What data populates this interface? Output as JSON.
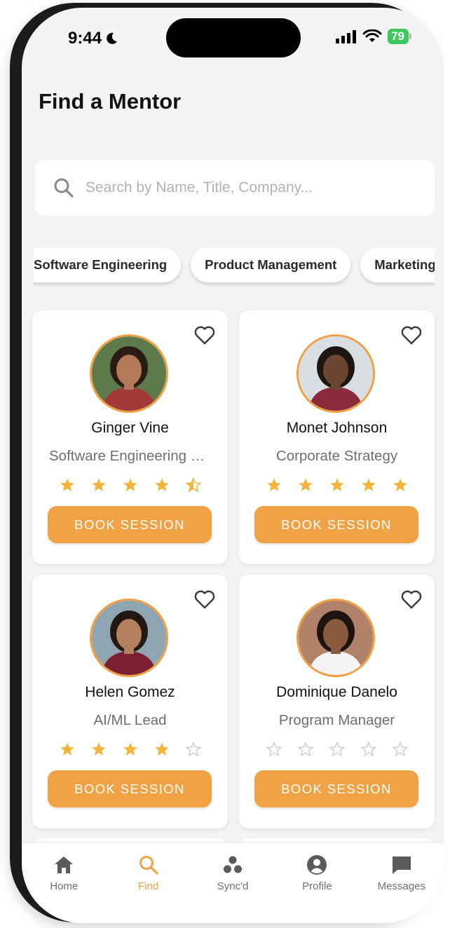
{
  "status_bar": {
    "time": "9:44",
    "battery": "79"
  },
  "header": {
    "title": "Find a Mentor"
  },
  "search": {
    "placeholder": "Search by Name, Title, Company..."
  },
  "categories": [
    "Software Engineering",
    "Product Management",
    "Marketing"
  ],
  "mentors": [
    {
      "name": "Ginger Vine",
      "title": "Software Engineering Manager",
      "rating": 4.5,
      "button": "BOOK SESSION",
      "avatar_bg": "#5d7a4b",
      "avatar_skin": "#b27a58",
      "avatar_hair": "#2a1c15",
      "avatar_shirt": "#a23a3a"
    },
    {
      "name": "Monet Johnson",
      "title": "Corporate Strategy",
      "rating": 5,
      "button": "BOOK SESSION",
      "avatar_bg": "#d9dee3",
      "avatar_skin": "#6b4632",
      "avatar_hair": "#1f1612",
      "avatar_shirt": "#8a2a3a"
    },
    {
      "name": "Helen Gomez",
      "title": "AI/ML Lead",
      "rating": 4,
      "button": "BOOK SESSION",
      "avatar_bg": "#8fa5b2",
      "avatar_skin": "#b48160",
      "avatar_hair": "#231711",
      "avatar_shirt": "#7c1f33"
    },
    {
      "name": "Dominique Danelo",
      "title": "Program Manager",
      "rating": 0,
      "button": "BOOK SESSION",
      "avatar_bg": "#b0826a",
      "avatar_skin": "#8a5a3e",
      "avatar_hair": "#1c1410",
      "avatar_shirt": "#f4f4f4"
    }
  ],
  "tabs": [
    {
      "label": "Home",
      "icon": "home-icon",
      "active": false
    },
    {
      "label": "Find",
      "icon": "search-icon",
      "active": true
    },
    {
      "label": "Sync'd",
      "icon": "sync-dots-icon",
      "active": false
    },
    {
      "label": "Profile",
      "icon": "profile-icon",
      "active": false
    },
    {
      "label": "Messages",
      "icon": "message-icon",
      "active": false
    }
  ],
  "colors": {
    "accent": "#f0a244",
    "star": "#f4b43a",
    "star_empty": "#c9c9c9",
    "tab_inactive": "#5a5a5a"
  }
}
